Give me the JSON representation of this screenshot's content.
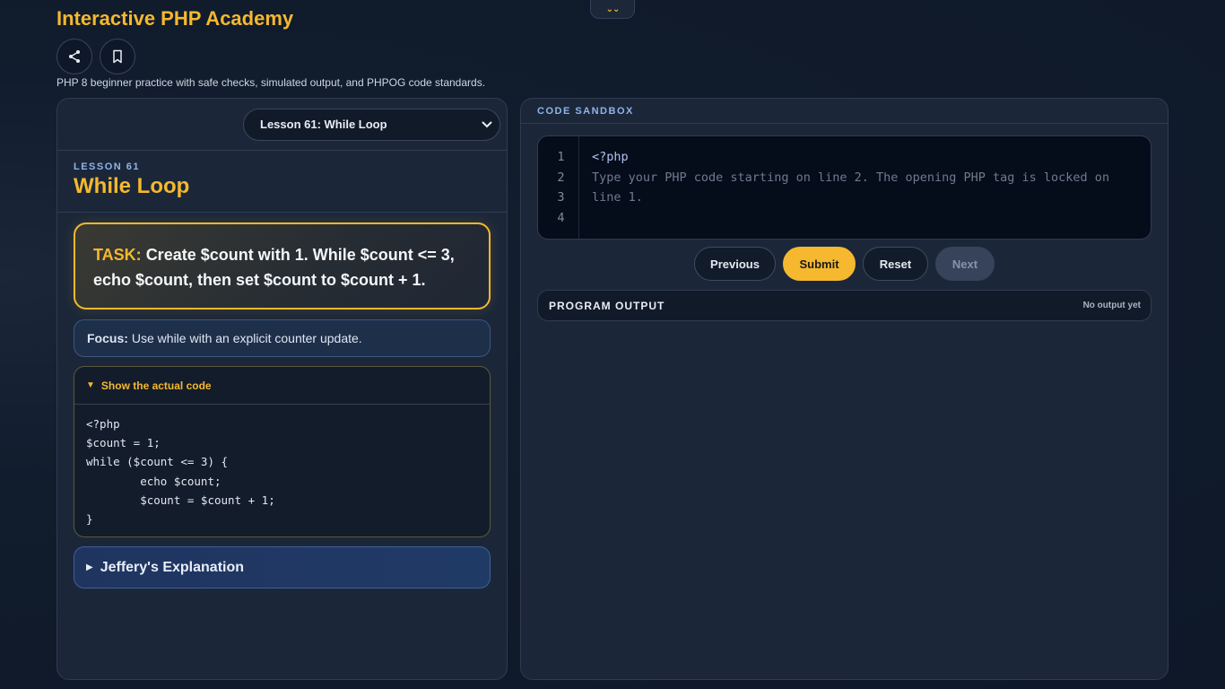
{
  "app": {
    "title": "Interactive PHP Academy",
    "subtitle": "PHP 8 beginner practice with safe checks, simulated output, and PHPOG code standards.",
    "toggle_glyph": "⌄⌄",
    "icons": [
      "share-icon",
      "bookmark-icon"
    ]
  },
  "lesson": {
    "selected_option": "Lesson 61: While Loop",
    "number_label": "LESSON 61",
    "title": "While Loop",
    "task_label": "TASK:",
    "task_text": "Create $count with 1. While $count <= 3, echo $count, then set $count to $count + 1.",
    "focus_label": "Focus:",
    "focus_text": "Use while with an explicit counter update.",
    "code_toggle_label": "Show the actual code",
    "code": "<?php\n$count = 1;\nwhile ($count <= 3) {\n        echo $count;\n        $count = $count + 1;\n}",
    "explanation_label": "Jeffery's Explanation"
  },
  "sandbox": {
    "header": "CODE SANDBOX",
    "line_numbers": "1\n2\n3\n4",
    "locked_line": "<?php",
    "placeholder": "Type your PHP code starting on line 2. The opening PHP tag is locked on line 1.",
    "buttons": {
      "previous": "Previous",
      "submit": "Submit",
      "reset": "Reset",
      "next": "Next"
    },
    "output_label": "PROGRAM OUTPUT",
    "output_status": "No output yet"
  },
  "colors": {
    "accent": "#f5b82e",
    "label_blue": "#8fb4e8",
    "background": "#0f1a2b"
  }
}
